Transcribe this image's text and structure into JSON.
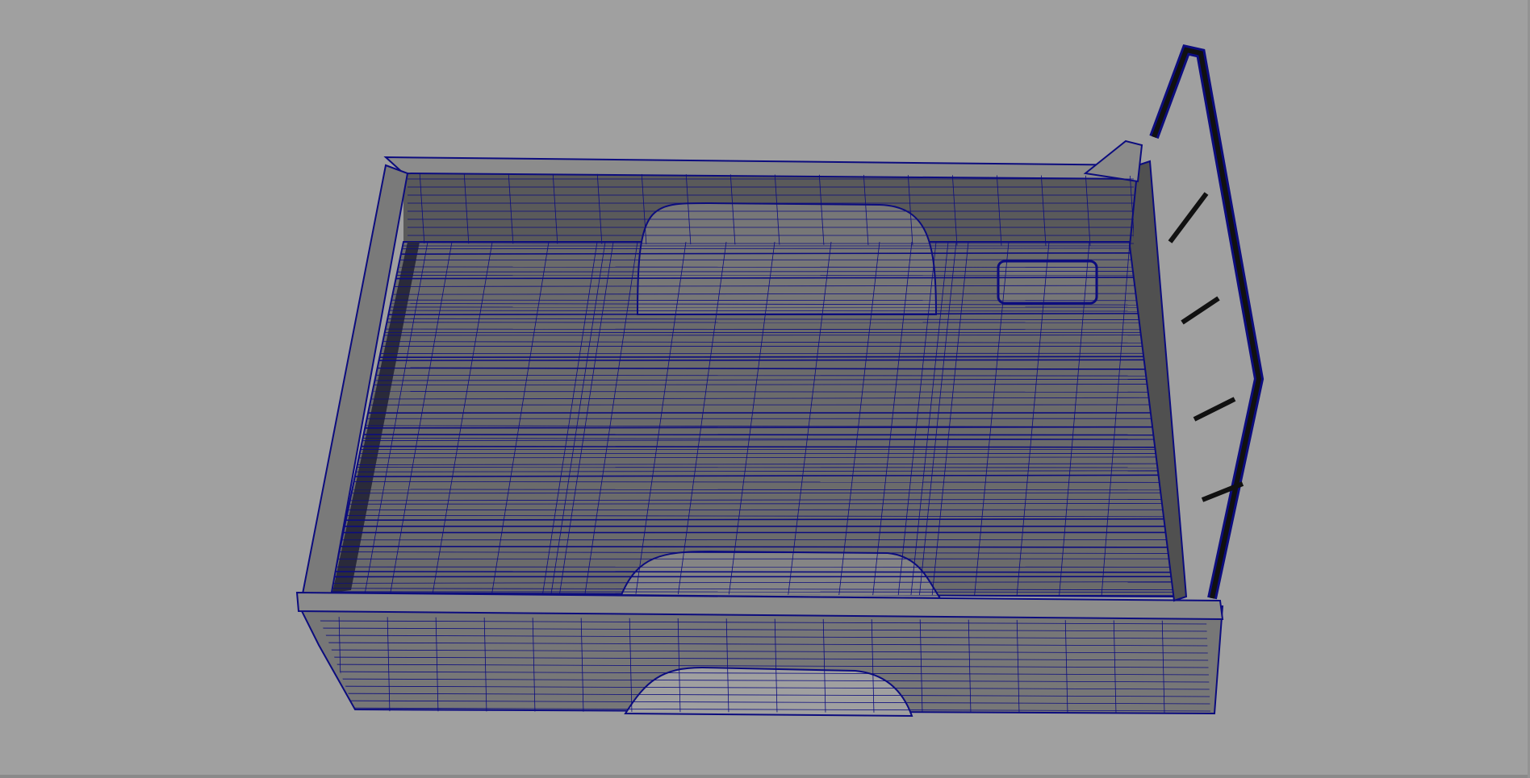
{
  "app": {
    "viewport": {
      "background_color": "#a0a0a0",
      "wire_color": "#0c0c7e",
      "shade_light": "#8a8a8a",
      "shade_mid": "#6c6c6c",
      "shade_dark": "#4f4f4f",
      "model": "pickup-truck-bed-wireframe"
    }
  }
}
